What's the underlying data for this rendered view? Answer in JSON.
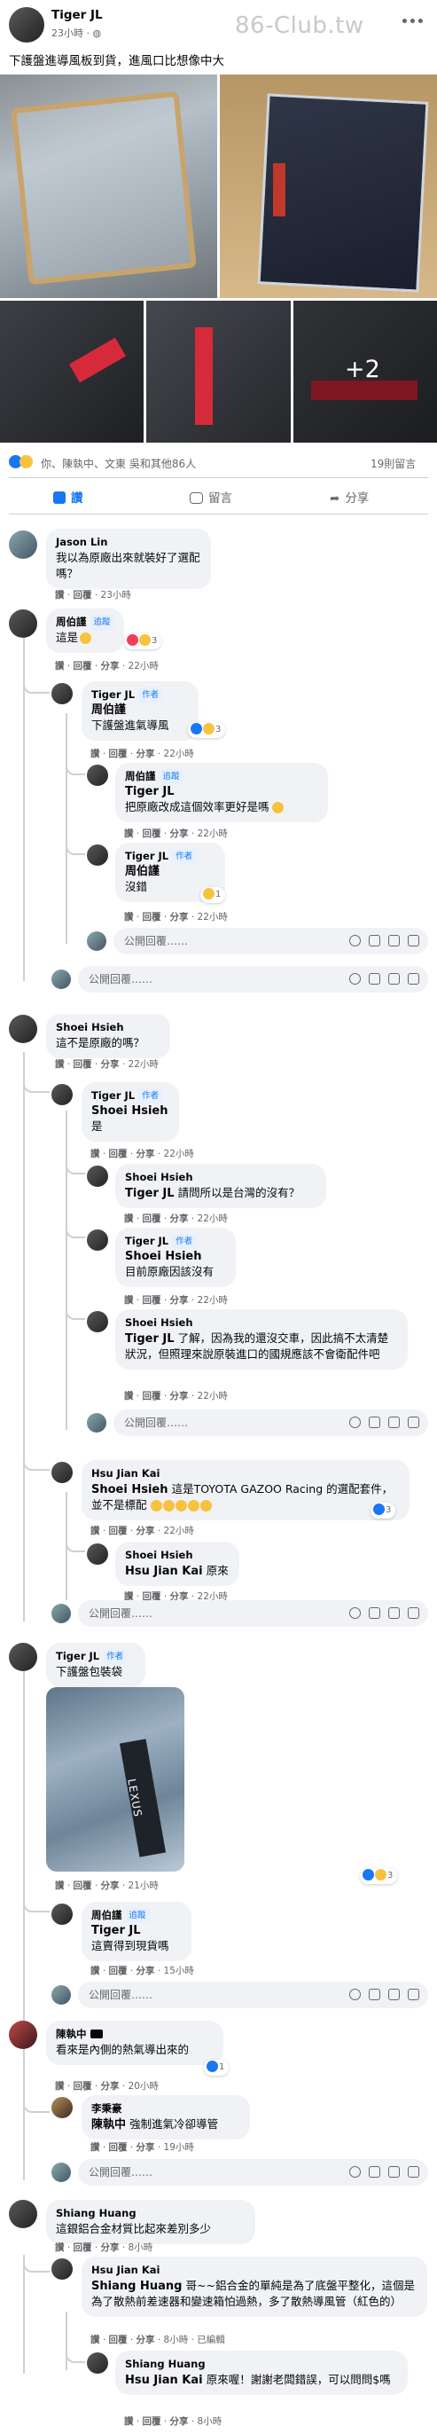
{
  "post": {
    "author": "Tiger JL",
    "time": "23小時",
    "watermark": "86-Club.tw",
    "more": "•••",
    "text": "下護盤進導風板到貨，進風口比想像中大",
    "more_photos": "+2",
    "reactions_summary": "你、陳執中、文東 吳和其他86人",
    "comment_count": "19則留言"
  },
  "actions": {
    "like": "讚",
    "comment": "留言",
    "share": "分享"
  },
  "labels": {
    "like": "讚",
    "reply": "回覆",
    "share": "分享",
    "author_badge": "作者",
    "follow": "追蹤",
    "reply_placeholder": "公開回覆……",
    "edited": "已編輯"
  },
  "comments": [
    {
      "id": "c1",
      "name": "Jason Lin",
      "text": "我以為原廠出來就裝好了選配嗎？",
      "time": "23小時"
    },
    {
      "id": "c2",
      "name": "周伯謹",
      "tag": "追蹤",
      "text": "這是",
      "react_count": "3",
      "time": "22小時"
    },
    {
      "id": "c3",
      "name": "Tiger JL",
      "tag": "作者",
      "mention": "周伯謹",
      "text": "下護盤進氣導風",
      "react_count": "3",
      "time": "22小時"
    },
    {
      "id": "c4",
      "name": "周伯謹",
      "tag": "追蹤",
      "mention": "Tiger JL",
      "text": "把原廠改成這個效率更好是嗎",
      "time": "22小時"
    },
    {
      "id": "c5",
      "name": "Tiger JL",
      "tag": "作者",
      "mention": "周伯謹",
      "text": "沒錯",
      "react_count": "1",
      "time": "22小時"
    },
    {
      "id": "c6",
      "name": "Shoei Hsieh",
      "text": "這不是原廠的嗎？",
      "time": "22小時"
    },
    {
      "id": "c7",
      "name": "Tiger JL",
      "tag": "作者",
      "mention": "Shoei Hsieh",
      "text": "是",
      "time": "22小時"
    },
    {
      "id": "c8",
      "name": "Shoei Hsieh",
      "mention": "Tiger JL",
      "text": "請問所以是台灣的沒有？",
      "time": "22小時"
    },
    {
      "id": "c9",
      "name": "Tiger JL",
      "tag": "作者",
      "mention": "Shoei Hsieh",
      "text": "目前原廠因該沒有",
      "time": "22小時"
    },
    {
      "id": "c10",
      "name": "Shoei Hsieh",
      "mention": "Tiger JL",
      "text": "了解，因為我的還沒交車，因此搞不太清楚狀況，但照理來說原裝進口的國規應該不會衛配件吧",
      "time": "22小時"
    },
    {
      "id": "c11",
      "name": "Hsu Jian Kai",
      "mention": "Shoei Hsieh",
      "text": "這是TOYOTA GAZOO Racing 的選配套件，並不是標配",
      "react_count": "3",
      "time": "22小時"
    },
    {
      "id": "c12",
      "name": "Shoei Hsieh",
      "mention": "Hsu Jian Kai",
      "text": "原來",
      "time": "22小時"
    },
    {
      "id": "c13",
      "name": "Tiger JL",
      "tag": "作者",
      "text": "下護盤包裝袋",
      "react_count": "3",
      "time": "21小時"
    },
    {
      "id": "c14",
      "name": "周伯謹",
      "tag": "追蹤",
      "mention": "Tiger JL",
      "text": "這賣得到現貨嗎",
      "time": "15小時"
    },
    {
      "id": "c15",
      "name": "陳執中",
      "text": "看來是內側的熱氣導出來的",
      "react_count": "1",
      "time": "20小時"
    },
    {
      "id": "c16",
      "name": "李秉豪",
      "mention": "陳執中",
      "text": "強制進氣冷卻導管",
      "time": "19小時"
    },
    {
      "id": "c17",
      "name": "Shiang Huang",
      "text": "這銀鋁合金材質比起來差別多少",
      "time": "8小時"
    },
    {
      "id": "c18",
      "name": "Hsu Jian Kai",
      "mention": "Shiang Huang",
      "text": "哥~~鋁合金的單純是為了底盤平整化，這個是為了散熱前差速器和變速箱怕過熱，多了散熱導風管（紅色的）",
      "time": "8小時"
    },
    {
      "id": "c19",
      "name": "Shiang Huang",
      "mention": "Hsu Jian Kai",
      "text": "原來喔！謝謝老闆錯誤，可以問問$嗎",
      "time": "8小時"
    }
  ],
  "badge_text": "LEXUS",
  "colors": {
    "link": "#1877f2",
    "muted": "#65676b",
    "bubble": "#f0f2f5",
    "divider": "#ced0d4"
  }
}
